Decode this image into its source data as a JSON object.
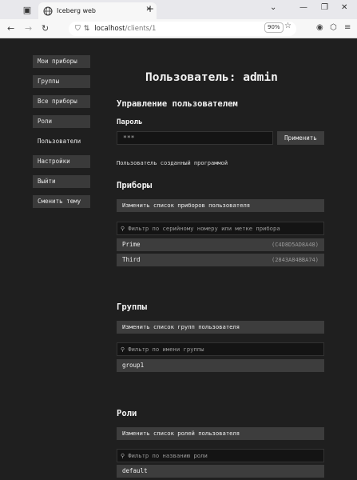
{
  "browser": {
    "tab_title": "Iceberg web",
    "tab_close": "✕",
    "new_tab": "+",
    "url_host": "localhost",
    "url_path": "/clients/1",
    "zoom": "90%",
    "window": {
      "dropdown": "⌄",
      "minimize": "—",
      "restore": "❐",
      "close": "✕"
    }
  },
  "sidebar": {
    "items": [
      {
        "label": "Мои приборы"
      },
      {
        "label": "Группы"
      },
      {
        "label": "Все приборы"
      },
      {
        "label": "Роли"
      },
      {
        "label": "Пользователи"
      },
      {
        "label": "Настройки"
      },
      {
        "label": "Выйти"
      },
      {
        "label": "Сменить тему"
      }
    ]
  },
  "main": {
    "title": "Пользователь: admin",
    "manage_heading": "Управление пользователем",
    "password_label": "Пароль",
    "password_value": "***",
    "apply_label": "Применить",
    "note": "Пользователь созданный программой",
    "devices": {
      "heading": "Приборы",
      "edit_label": "Изменить список приборов пользователя",
      "filter_placeholder": "Фильтр по серийному номеру или метке прибора",
      "rows": [
        {
          "name": "Prime",
          "serial": "(C4D8D5AD8A48)"
        },
        {
          "name": "Third",
          "serial": "(2843A84BBA74)"
        }
      ]
    },
    "groups": {
      "heading": "Группы",
      "edit_label": "Изменить список групп пользователя",
      "filter_placeholder": "Фильтр по имени группы",
      "rows": [
        {
          "name": "group1"
        }
      ]
    },
    "roles": {
      "heading": "Роли",
      "edit_label": "Изменить список ролей пользователя",
      "filter_placeholder": "Фильтр по названию роли",
      "rows": [
        {
          "name": "default"
        }
      ]
    }
  }
}
